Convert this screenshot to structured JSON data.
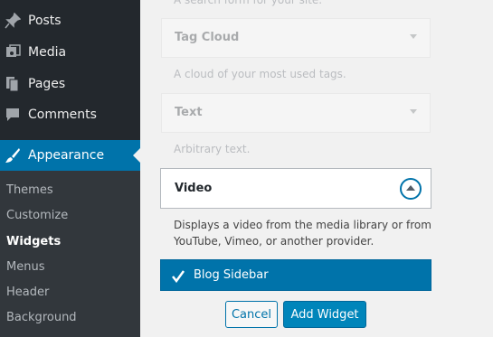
{
  "sidebar": {
    "items": [
      {
        "label": "Posts",
        "icon": "pin-icon"
      },
      {
        "label": "Media",
        "icon": "media-icon"
      },
      {
        "label": "Pages",
        "icon": "pages-icon"
      },
      {
        "label": "Comments",
        "icon": "comment-icon"
      }
    ],
    "current": {
      "label": "Appearance",
      "icon": "paintbrush-icon"
    },
    "submenu": [
      "Themes",
      "Customize",
      "Widgets",
      "Menus",
      "Header",
      "Background"
    ],
    "active_submenu": "Widgets"
  },
  "widgets": {
    "search_desc_partial": "A search form for your site.",
    "tag_cloud": {
      "title": "Tag Cloud",
      "desc": "A cloud of your most used tags."
    },
    "text": {
      "title": "Text",
      "desc": "Arbitrary text."
    },
    "video": {
      "title": "Video",
      "desc": "Displays a video from the media library or from YouTube, Vimeo, or another provider."
    }
  },
  "sidebar_choice": {
    "label": "Blog Sidebar"
  },
  "actions": {
    "cancel": "Cancel",
    "add": "Add Widget"
  },
  "colors": {
    "sidebar_bg": "#23282d",
    "accent": "#0073aa",
    "primary_button": "#0085ba"
  }
}
